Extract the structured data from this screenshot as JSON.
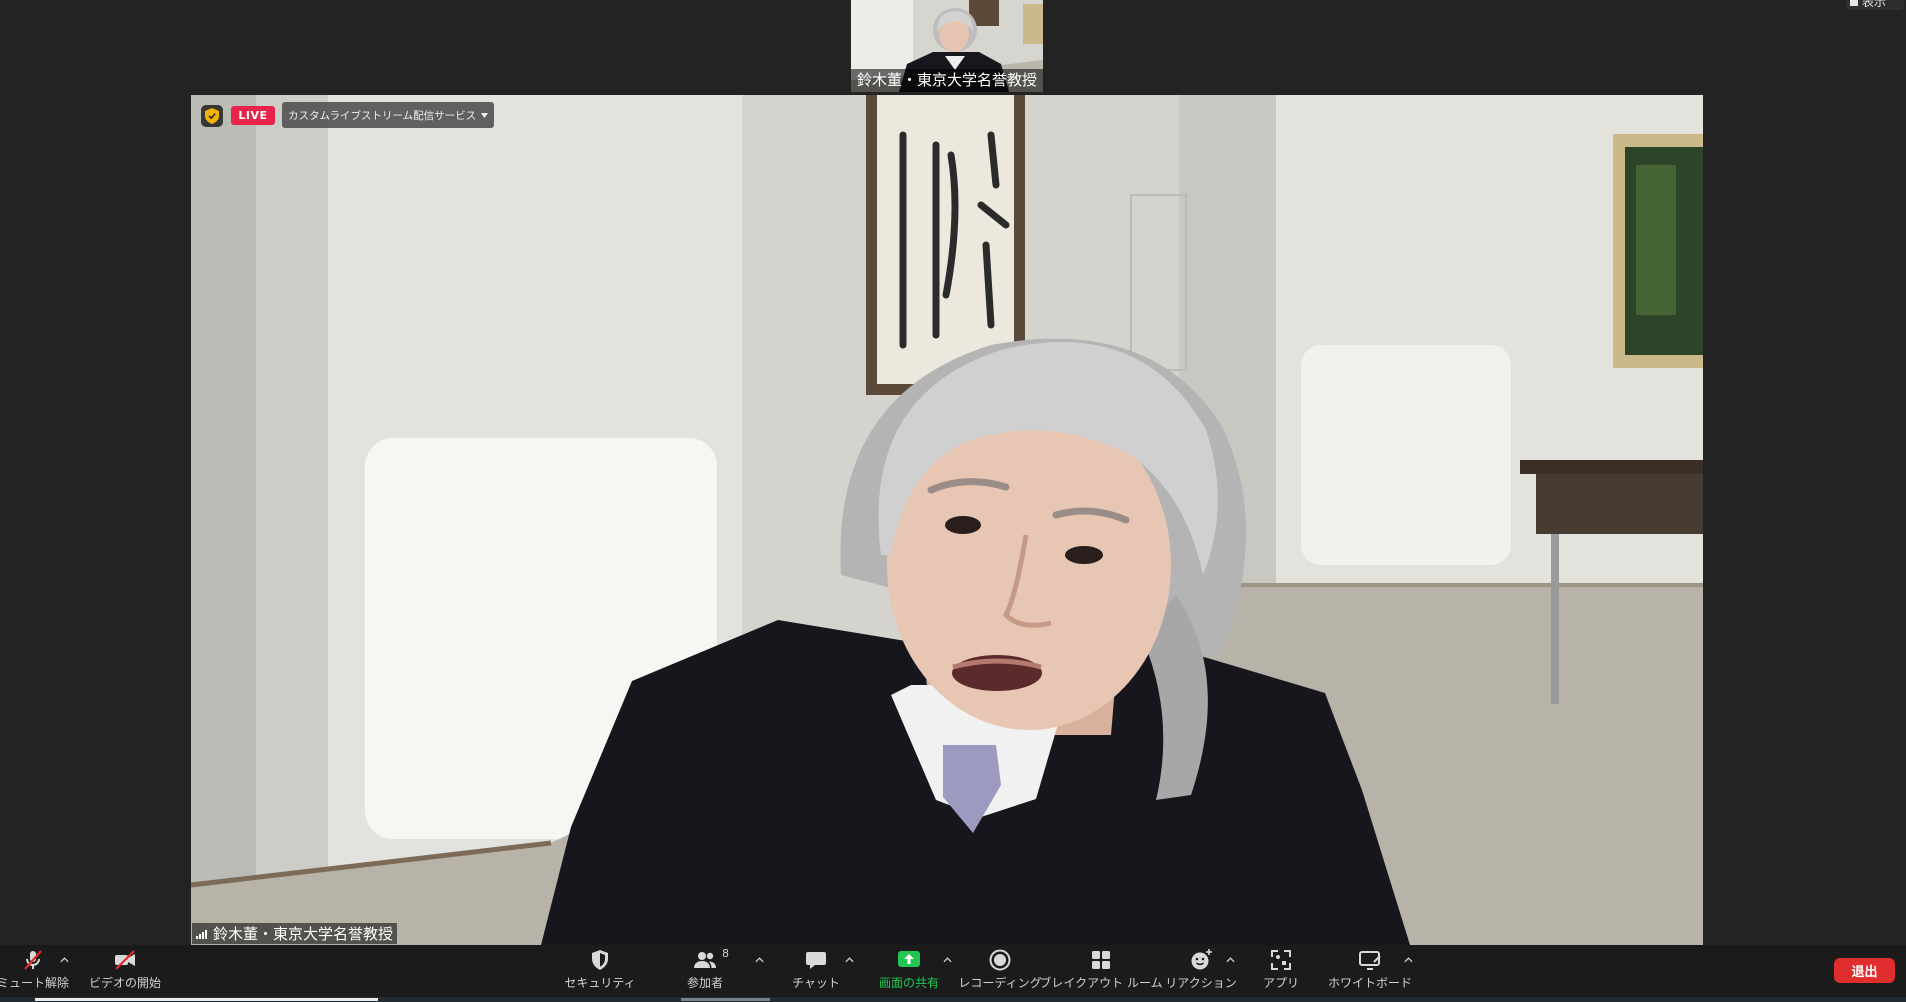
{
  "window": {
    "view_label": "表示",
    "view_icon": "view-square-icon"
  },
  "participant_thumbnail": {
    "participant_name": "鈴木董・東京大学名誉教授"
  },
  "main_video": {
    "security_icon": "shield-icon",
    "live_badge": "LIVE",
    "livestream_service": "カスタムライブストリーム配信サービス",
    "livestream_menu_icon": "caret-down-icon",
    "signal_icon": "signal-bars-icon",
    "participant_name": "鈴木董・東京大学名誉教授"
  },
  "toolbar": {
    "unmute": {
      "label": "ミュート解除",
      "icon": "microphone-muted-icon",
      "menu_icon": "chevron-up-icon"
    },
    "start_video": {
      "label": "ビデオの開始",
      "icon": "video-camera-off-icon"
    },
    "security": {
      "label": "セキュリティ",
      "icon": "shield-icon"
    },
    "participants": {
      "label": "参加者",
      "count": "8",
      "icon": "participants-icon",
      "menu_icon": "chevron-up-icon"
    },
    "chat": {
      "label": "チャット",
      "icon": "chat-bubble-icon",
      "menu_icon": "chevron-up-icon"
    },
    "share_screen": {
      "label": "画面の共有",
      "icon": "share-screen-icon",
      "menu_icon": "chevron-up-icon"
    },
    "record": {
      "label": "レコーディング",
      "icon": "record-icon"
    },
    "breakout_rooms": {
      "label": "ブレイクアウト ルーム",
      "icon": "breakout-rooms-icon"
    },
    "reactions": {
      "label": "リアクション",
      "icon": "reaction-smiley-icon",
      "menu_icon": "chevron-up-icon"
    },
    "apps": {
      "label": "アプリ",
      "icon": "apps-icon"
    },
    "whiteboard": {
      "label": "ホワイトボード",
      "icon": "whiteboard-icon",
      "menu_icon": "chevron-up-icon"
    },
    "leave": {
      "label": "退出"
    }
  },
  "colors": {
    "live_badge": "#e8234a",
    "share_green": "#23c552",
    "leave_red": "#e02d2d",
    "security_shield": "#f5b301",
    "muted_slash": "#e02828"
  }
}
